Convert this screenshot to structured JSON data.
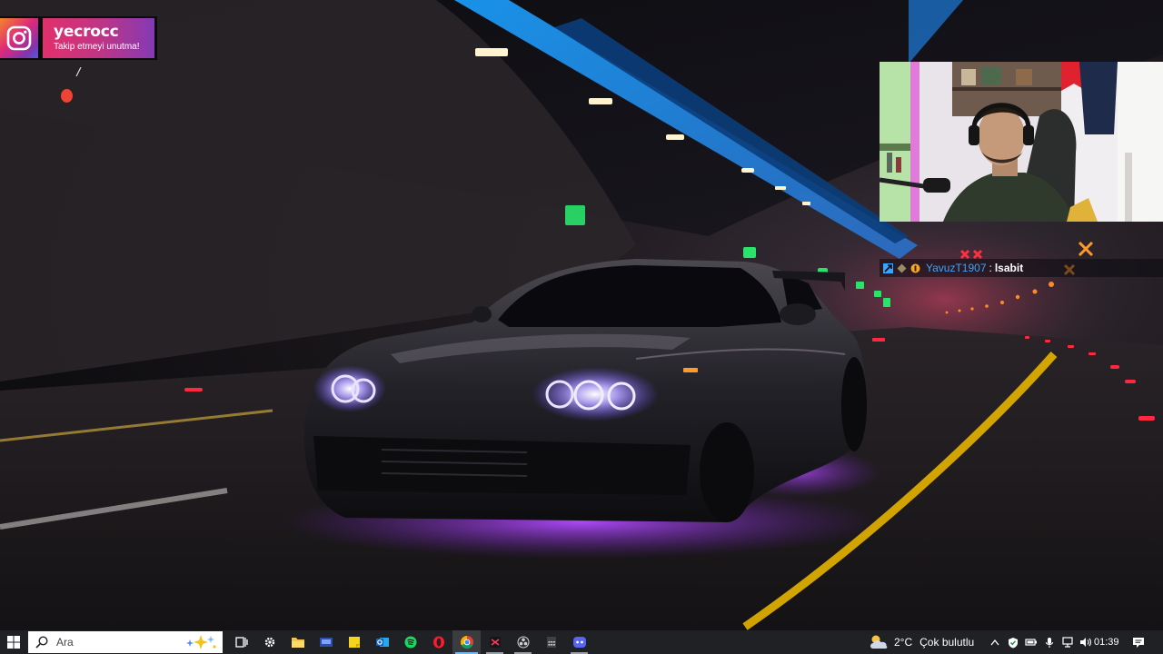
{
  "instagram": {
    "username": "yecrocc",
    "tagline": "Takip etmeyi unutma!"
  },
  "chat": {
    "username": "YavuzT1907",
    "separator": ":",
    "message": "lsabit"
  },
  "taskbar": {
    "search_placeholder": "Ara",
    "apps": [
      {
        "icon": "task-view-icon",
        "state": "idle"
      },
      {
        "icon": "settings-gear-icon",
        "state": "idle"
      },
      {
        "icon": "file-explorer-icon",
        "state": "idle"
      },
      {
        "icon": "monitor-app-icon",
        "state": "idle"
      },
      {
        "icon": "sticky-notes-icon",
        "state": "idle"
      },
      {
        "icon": "outlook-icon",
        "state": "idle"
      },
      {
        "icon": "spotify-icon",
        "state": "idle"
      },
      {
        "icon": "opera-icon",
        "state": "idle"
      },
      {
        "icon": "chrome-icon",
        "state": "active"
      },
      {
        "icon": "capcut-icon",
        "state": "running"
      },
      {
        "icon": "obs-icon",
        "state": "running"
      },
      {
        "icon": "calculator-icon",
        "state": "idle"
      },
      {
        "icon": "discord-icon",
        "state": "running"
      }
    ],
    "weather": {
      "temperature": "2°C",
      "condition": "Çok bulutlu"
    },
    "clock": "01:39"
  },
  "colors": {
    "taskbar_bg": "#202124",
    "instagram_gradient_start": "#e1306c",
    "instagram_gradient_end": "#833ab4",
    "chat_username": "#3aa5ff",
    "neon_underglow": "#8a2be2"
  }
}
